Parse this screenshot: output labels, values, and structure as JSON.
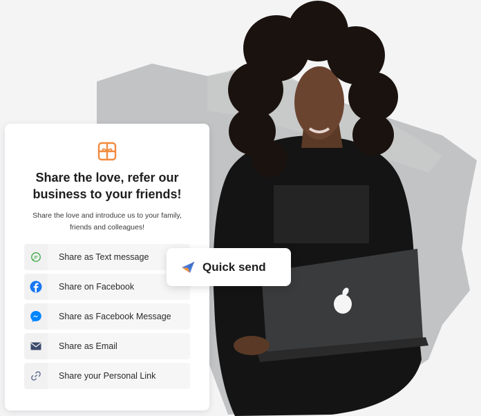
{
  "card": {
    "title": "Share the love, refer our business to your friends!",
    "subtitle": "Share the love and introduce us to your family, friends and colleagues!",
    "logo_icon": "gift-icon",
    "items": [
      {
        "label": "Share as Text message",
        "icon": "sms-icon",
        "color": "#4caf50"
      },
      {
        "label": "Share on Facebook",
        "icon": "facebook-icon",
        "color": "#1877f2"
      },
      {
        "label": "Share as Facebook Message",
        "icon": "messenger-icon",
        "color": "#0084ff"
      },
      {
        "label": "Share as Email",
        "icon": "email-icon",
        "color": "#3b4a6b"
      },
      {
        "label": "Share your Personal Link",
        "icon": "link-icon",
        "color": "#5a6a8a"
      }
    ]
  },
  "quick_send": {
    "label": "Quick send",
    "icon": "paper-plane-icon"
  },
  "colors": {
    "accent": "#f28a3c",
    "brush": "#b9babb"
  }
}
